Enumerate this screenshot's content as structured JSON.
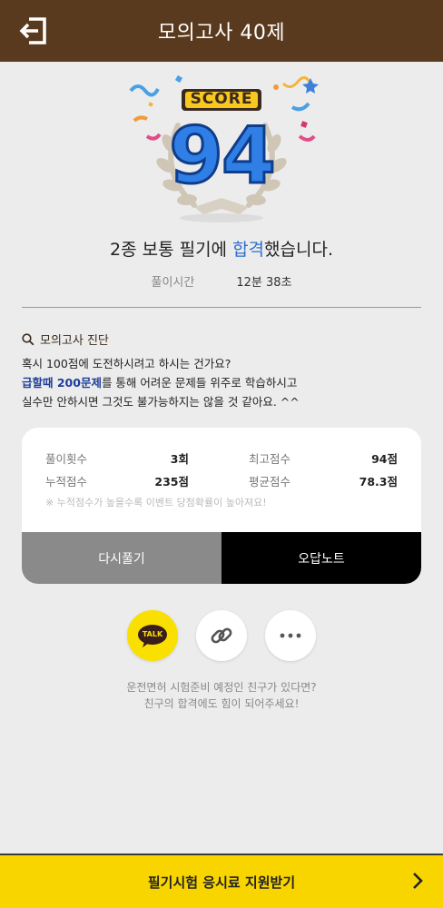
{
  "header": {
    "title": "모의고사 40제",
    "back_icon": "exit-icon"
  },
  "score": {
    "label": "SCORE",
    "value": "94"
  },
  "result": {
    "prefix": "2종 보통 필기에 ",
    "highlight": "합격",
    "suffix": "했습니다."
  },
  "time": {
    "label": "풀이시간",
    "value": "12분 38초"
  },
  "diagnosis": {
    "title": "모의고사 진단",
    "line1": "혹시 100점에 도전하시려고 하시는 건가요?",
    "line2_strong": "급할때 200문제",
    "line2_rest": "를 통해 어려운 문제들 위주로 학습하시고",
    "line3": "실수만 안하시면 그것도 불가능하지는 않을 것 같아요. ^^"
  },
  "stats": {
    "items": [
      {
        "label": "풀이횟수",
        "value": "3회"
      },
      {
        "label": "최고점수",
        "value": "94점"
      },
      {
        "label": "누적점수",
        "value": "235점"
      },
      {
        "label": "평균점수",
        "value": "78.3점"
      }
    ],
    "note": "※ 누적점수가 높을수록 이벤트 당첨확률이 높아져요!",
    "retry_label": "다시풀기",
    "wrong_note_label": "오답노트"
  },
  "share": {
    "kakao_label": "TALK",
    "message_line1": "운전면허 시험준비 예정인 친구가 있다면?",
    "message_line2": "친구의 합격에도 힘이 되어주세요!"
  },
  "cta": {
    "label": "필기시험 응시료 지원받기"
  },
  "colors": {
    "header_bg": "#5a3a1e",
    "highlight": "#2d6fcf",
    "cta_bg": "#f9d500",
    "kakao": "#f9e000"
  }
}
